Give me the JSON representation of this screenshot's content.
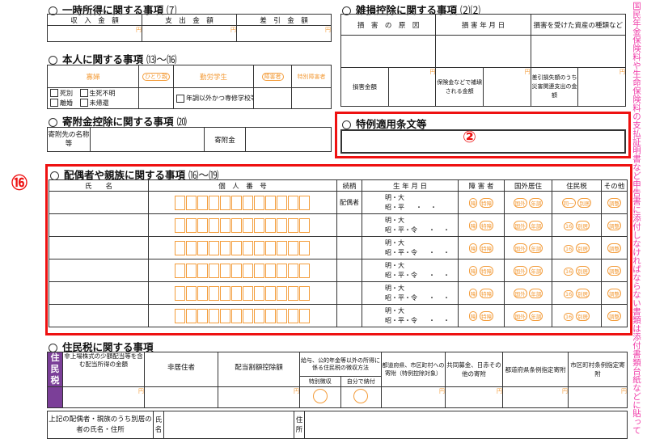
{
  "s1": {
    "title": "一時所得に関する事項",
    "num": "⑺",
    "cols": [
      "収　入　金　額",
      "支　出　金　額",
      "差　引　金　額"
    ],
    "unit": "円"
  },
  "s2": {
    "title": "雑損控除に関する事項",
    "num": "⑵⑵",
    "cols": [
      "損　害　の　原　因",
      "損 害 年 月 日",
      "損害を受けた資産の種類など"
    ],
    "loss_amount": "損害金額",
    "insurance": "保険金などで補塡される金額",
    "deductible": "差引損失額のうち災害関連支出の金額",
    "unit": "円"
  },
  "s3": {
    "title": "本人に関する事項",
    "num": "⒀〜⒃",
    "widow": "寡婦",
    "single_parent": "ひとり親",
    "working_student": "勤労学生",
    "disabled": "障害者",
    "special_disabled": "特別障害者",
    "dead": "死別",
    "unknown": "生死不明",
    "divorced": "離婚",
    "not_returned": "未帰還",
    "other_school": "年調以外かつ専修学校等"
  },
  "s4": {
    "title": "寄附金控除に関する事項",
    "num": "⒇",
    "donee": "寄附先の名称等",
    "amount": "寄附金"
  },
  "s5": {
    "title": "特例適用条文等"
  },
  "marker2": "②",
  "marker16": "⑯",
  "s6": {
    "title": "配偶者や親族に関する事項",
    "num": "⒃〜⒆",
    "h_name": "氏　　名",
    "h_number": "個　人　番　号",
    "h_rel": "続柄",
    "h_birth": "生 年 月 日",
    "h_disability": "障 害 者",
    "h_abroad": "国外居住",
    "h_resident": "住民税",
    "h_other": "その他",
    "spouse": "配偶者",
    "era1": "明・大",
    "era2": "昭・平",
    "era3": "昭・平・令",
    "m_dis": "障",
    "m_special": "特障",
    "m_abroad": "国外",
    "m_nentyo": "年調",
    "m_same": "同一",
    "m_16": "16",
    "m_separate": "別居",
    "m_adjust": "調整"
  },
  "s7": {
    "title": "住民税に関する事項",
    "side": "住民税",
    "c1": "非上場株式の少額配当等を含む配当所得の金額",
    "c2": "非居住者",
    "c3": "配当割額控除額",
    "c4": "給与、公的年金等以外の所得に係る住民税の徴収方法",
    "c4a": "特別徴収",
    "c4b": "自分で納付",
    "c5": "都道府県、市区町村への寄附（特例控除対象）",
    "c6": "共同募金、日赤その他の寄附",
    "c7": "都道府県条例指定寄附",
    "c8": "市区町村条例指定寄附",
    "unit": "円"
  },
  "s8": {
    "label": "上記の配偶者・親族のうち別居の者の氏名・住所",
    "name": "氏名",
    "address": "住所"
  },
  "side_text": "国民年金保険料や生命保険料の支払証明書など申告書に添付しなければならない書類は添付書類台紙などに貼ってください。"
}
